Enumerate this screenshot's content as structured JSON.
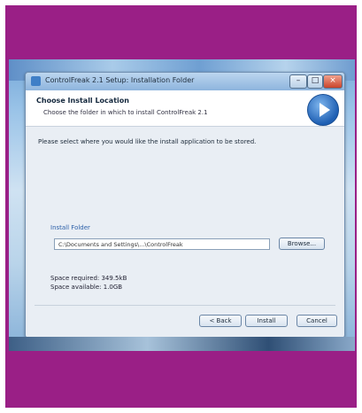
{
  "window": {
    "title": "ControlFreak 2.1 Setup: Installation Folder"
  },
  "title_buttons": {
    "minimize": "–",
    "maximize": "□",
    "close": "×"
  },
  "header": {
    "title": "Choose Install Location",
    "subtitle": "Choose the folder in which to install ControlFreak 2.1"
  },
  "body": {
    "description": "Please select where you would like the install application to be stored.",
    "folder_label": "Install Folder",
    "folder_path": "C:\\Documents and Settings\\...\\ControlFreak",
    "browse_label": "Browse...",
    "space_required": "Space required: 349.5kB",
    "space_available": "Space available: 1.0GB"
  },
  "buttons": {
    "back": "< Back",
    "install": "Install",
    "cancel": "Cancel"
  },
  "colors": {
    "frame": "#9a1f86",
    "accent": "#1e5fb3"
  }
}
